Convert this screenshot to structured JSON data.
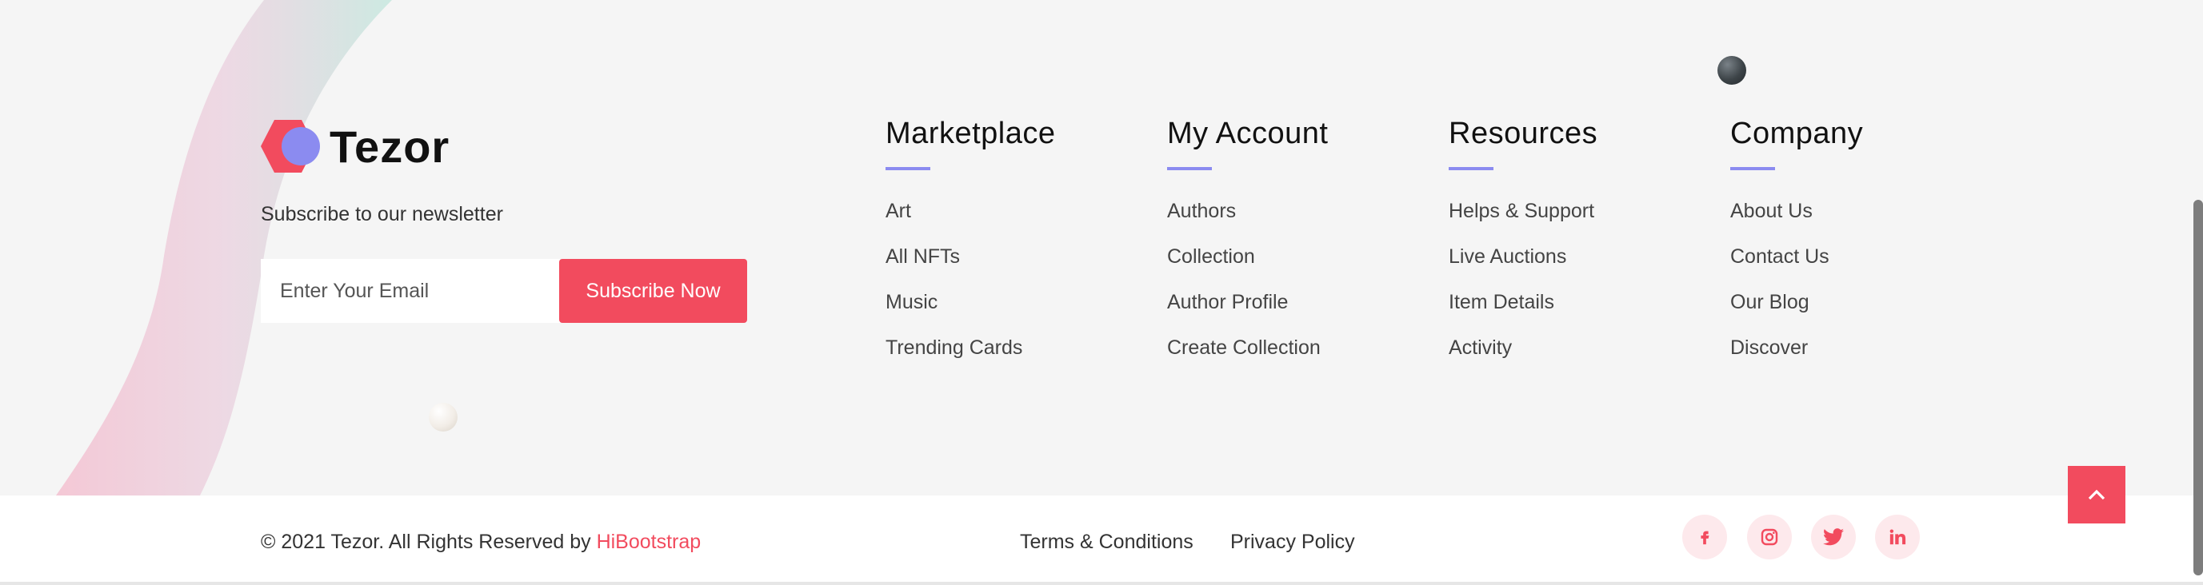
{
  "brand": {
    "name": "Tezor",
    "newsletter_text": "Subscribe to our newsletter"
  },
  "newsletter": {
    "placeholder": "Enter Your Email",
    "button_label": "Subscribe Now"
  },
  "columns": [
    {
      "title": "Marketplace",
      "links": [
        "Art",
        "All NFTs",
        "Music",
        "Trending Cards"
      ]
    },
    {
      "title": "My Account",
      "links": [
        "Authors",
        "Collection",
        "Author Profile",
        "Create Collection"
      ]
    },
    {
      "title": "Resources",
      "links": [
        "Helps & Support",
        "Live Auctions",
        "Item Details",
        "Activity"
      ]
    },
    {
      "title": "Company",
      "links": [
        "About Us",
        "Contact Us",
        "Our Blog",
        "Discover"
      ]
    }
  ],
  "bottom": {
    "copyright": "© 2021 Tezor. All Rights Reserved by",
    "credit_link": "HiBootstrap",
    "terms": "Terms & Conditions",
    "privacy": "Privacy Policy"
  },
  "social": [
    "facebook-icon",
    "instagram-icon",
    "twitter-icon",
    "linkedin-icon"
  ],
  "colors": {
    "accent": "#f24b5e",
    "underline": "#8b8bf0",
    "logo_red": "#f24b5e",
    "logo_blue": "#8b8bf0"
  }
}
